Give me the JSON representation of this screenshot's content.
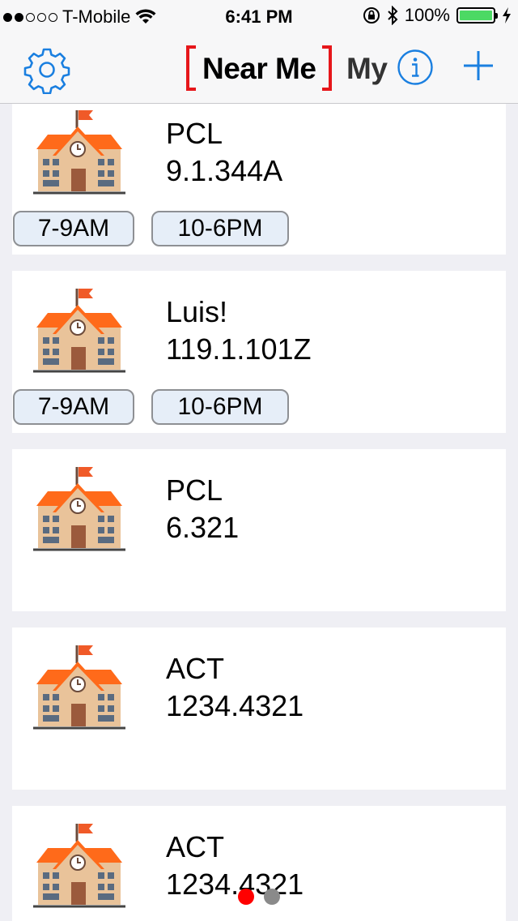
{
  "status_bar": {
    "carrier": "T-Mobile",
    "time": "6:41 PM",
    "battery": "100%",
    "signal_bars_filled": 2,
    "signal_bars_total": 5,
    "battery_level": 1.0,
    "icons": [
      "wifi-icon",
      "orientation-lock-icon",
      "bluetooth-icon",
      "battery-icon",
      "charging-icon"
    ]
  },
  "nav": {
    "settings_icon": "gear-icon",
    "tabs": [
      {
        "label": "Near Me",
        "selected": true
      },
      {
        "label": "My",
        "selected": false
      }
    ],
    "info_icon": "info-icon",
    "add_icon": "plus-icon",
    "accent_color": "#1a7fe0",
    "selected_bracket_color": "#e6161a"
  },
  "cards": [
    {
      "name": "PCL",
      "code": "9.1.344A",
      "hours": [
        "7-9AM",
        "10-6PM"
      ]
    },
    {
      "name": "Luis!",
      "code": "119.1.101Z",
      "hours": [
        "7-9AM",
        "10-6PM"
      ]
    },
    {
      "name": "PCL",
      "code": "6.321",
      "hours": []
    },
    {
      "name": "ACT",
      "code": "1234.4321",
      "hours": []
    },
    {
      "name": "ACT",
      "code": "1234.4321",
      "hours": []
    }
  ],
  "pager": {
    "pages": 2,
    "current": 0,
    "active_color": "#ff0000",
    "inactive_color": "#8a8a8a"
  }
}
